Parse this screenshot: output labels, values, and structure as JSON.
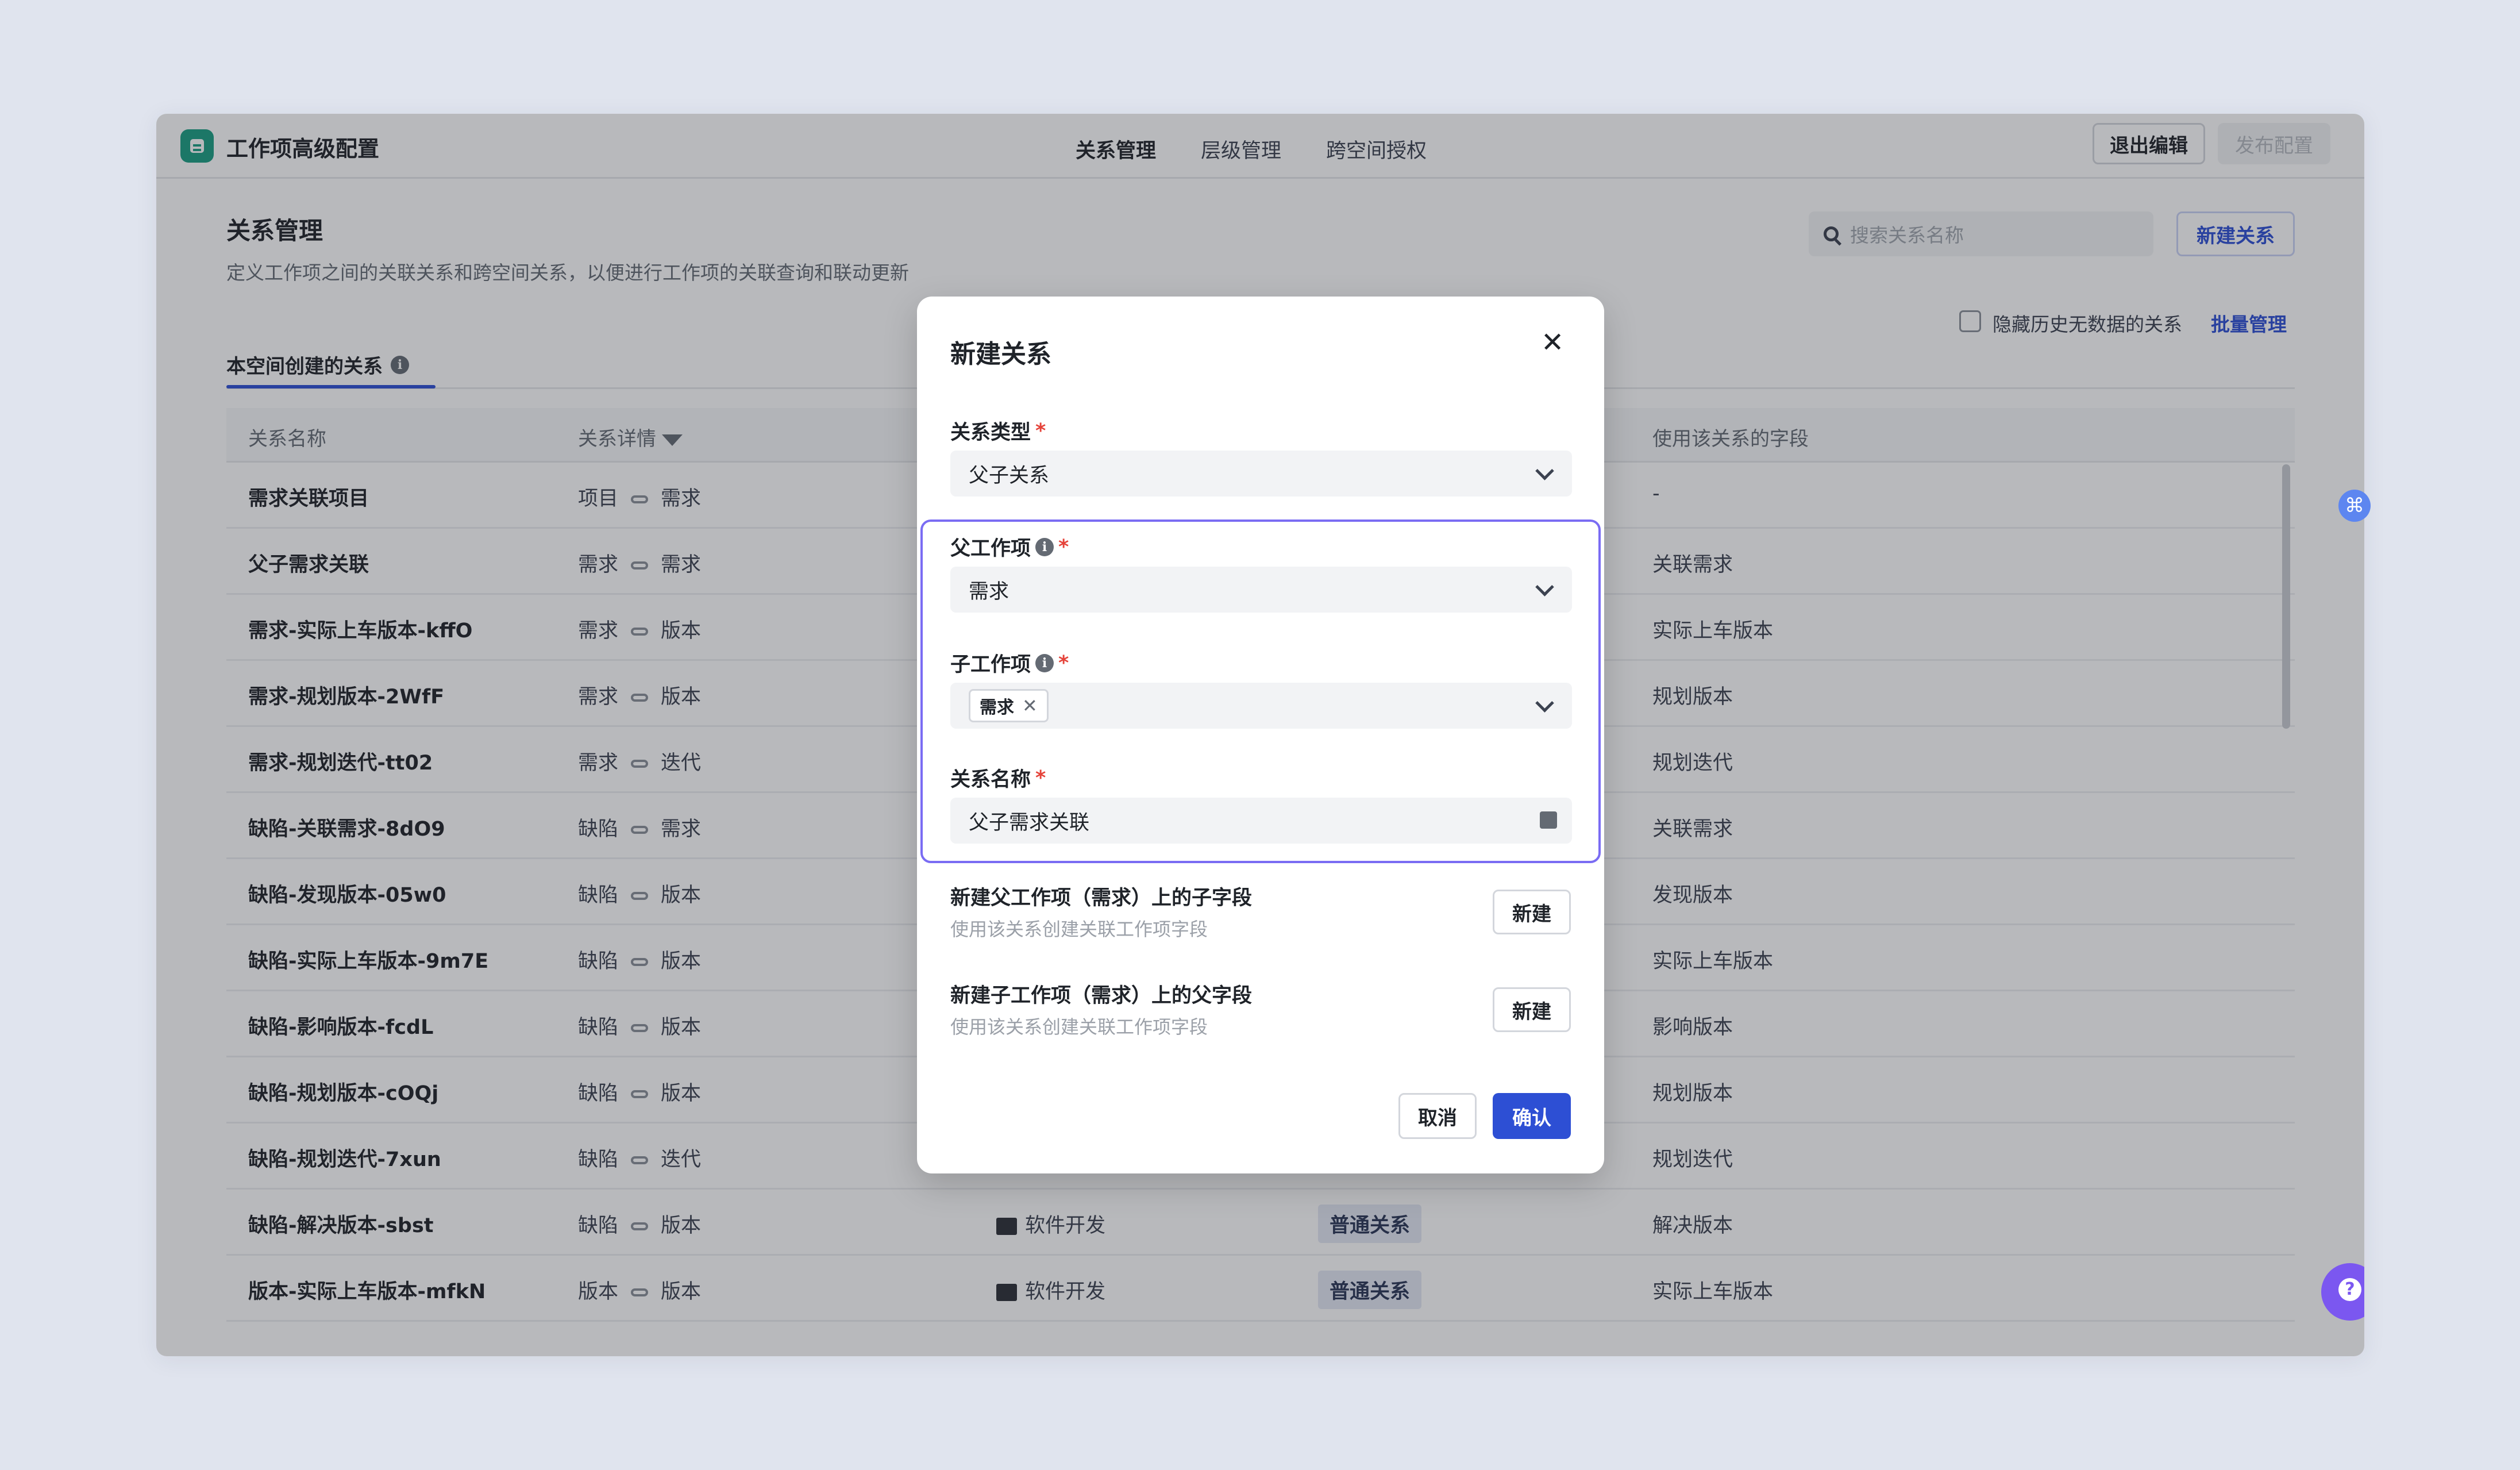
{
  "app": {
    "title": "工作项高级配置"
  },
  "top_tabs": [
    "关系管理",
    "层级管理",
    "跨空间授权"
  ],
  "top_actions": {
    "exit": "退出编辑",
    "publish": "发布配置"
  },
  "page": {
    "title": "关系管理",
    "description": "定义工作项之间的关联关系和跨空间关系，以便进行工作项的关联查询和联动更新",
    "search_placeholder": "搜索关系名称",
    "new_relation": "新建关系",
    "hide_label": "隐藏历史无数据的关系",
    "batch_manage": "批量管理",
    "sub_tab": "本空间创建的关系"
  },
  "table": {
    "headers": {
      "name": "关系名称",
      "detail": "关系详情",
      "field": "使用该关系的字段"
    },
    "rows": [
      {
        "name": "需求关联项目",
        "from": "项目",
        "to": "需求",
        "space": "",
        "type": "",
        "field": "-"
      },
      {
        "name": "父子需求关联",
        "from": "需求",
        "to": "需求",
        "space": "",
        "type": "",
        "field": "关联需求"
      },
      {
        "name": "需求-实际上车版本-kffO",
        "from": "需求",
        "to": "版本",
        "space": "",
        "type": "",
        "field": "实际上车版本"
      },
      {
        "name": "需求-规划版本-2WfF",
        "from": "需求",
        "to": "版本",
        "space": "",
        "type": "",
        "field": "规划版本"
      },
      {
        "name": "需求-规划迭代-tt02",
        "from": "需求",
        "to": "迭代",
        "space": "",
        "type": "",
        "field": "规划迭代"
      },
      {
        "name": "缺陷-关联需求-8dO9",
        "from": "缺陷",
        "to": "需求",
        "space": "",
        "type": "",
        "field": "关联需求"
      },
      {
        "name": "缺陷-发现版本-05w0",
        "from": "缺陷",
        "to": "版本",
        "space": "",
        "type": "",
        "field": "发现版本"
      },
      {
        "name": "缺陷-实际上车版本-9m7E",
        "from": "缺陷",
        "to": "版本",
        "space": "",
        "type": "",
        "field": "实际上车版本"
      },
      {
        "name": "缺陷-影响版本-fcdL",
        "from": "缺陷",
        "to": "版本",
        "space": "",
        "type": "",
        "field": "影响版本"
      },
      {
        "name": "缺陷-规划版本-cOQj",
        "from": "缺陷",
        "to": "版本",
        "space": "",
        "type": "",
        "field": "规划版本"
      },
      {
        "name": "缺陷-规划迭代-7xun",
        "from": "缺陷",
        "to": "迭代",
        "space": "",
        "type": "",
        "field": "规划迭代"
      },
      {
        "name": "缺陷-解决版本-sbst",
        "from": "缺陷",
        "to": "版本",
        "space": "软件开发",
        "type": "普通关系",
        "field": "解决版本"
      },
      {
        "name": "版本-实际上车版本-mfkN",
        "from": "版本",
        "to": "版本",
        "space": "软件开发",
        "type": "普通关系",
        "field": "实际上车版本"
      }
    ]
  },
  "modal": {
    "title": "新建关系",
    "relation_type_label": "关系类型",
    "relation_type_value": "父子关系",
    "parent_label": "父工作项",
    "parent_value": "需求",
    "child_label": "子工作项",
    "child_tag": "需求",
    "name_label": "关系名称",
    "name_value": "父子需求关联",
    "new_child_field_title": "新建父工作项（需求）上的子字段",
    "new_child_field_desc": "使用该关系创建关联工作项字段",
    "new_parent_field_title": "新建子工作项（需求）上的父字段",
    "new_parent_field_desc": "使用该关系创建关联工作项字段",
    "new_button": "新建",
    "cancel": "取消",
    "confirm": "确认",
    "required_mark": "*"
  },
  "colors": {
    "accent": "#2d4fd4",
    "brand": "#1a9e82",
    "focus_border": "#7a6cf3",
    "required": "#e5433a"
  },
  "icons": [
    "app-logo-icon",
    "search-icon",
    "filter-icon",
    "info-icon",
    "link-icon",
    "laptop-icon",
    "close-icon",
    "chevron-down-icon",
    "edit-icon",
    "help-icon",
    "command-icon"
  ]
}
